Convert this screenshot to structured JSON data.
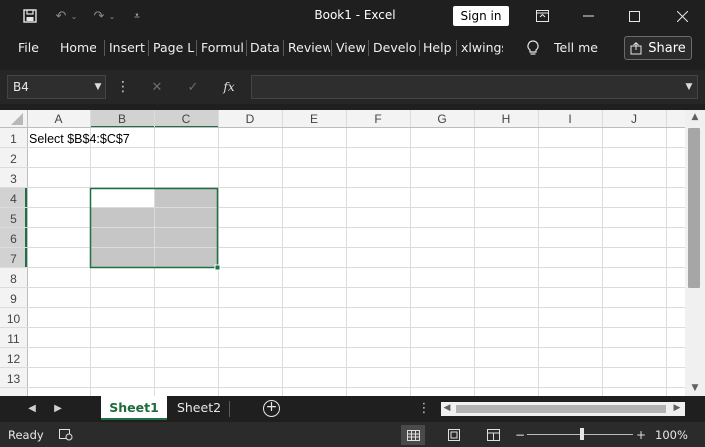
{
  "window": {
    "doc_title": "Book1  -  Excel",
    "sign_in_label": "Sign in"
  },
  "ribbon": {
    "tabs": [
      "File",
      "Home",
      "Insert",
      "Page L",
      "Formul",
      "Data",
      "Review",
      "View",
      "Develo",
      "Help",
      "xlwings"
    ],
    "tell_me": "Tell me",
    "share": "Share"
  },
  "formula_bar": {
    "name_box": "B4",
    "fx_symbol": "fx",
    "value": ""
  },
  "sheet": {
    "columns": [
      "A",
      "B",
      "C",
      "D",
      "E",
      "F",
      "G",
      "H",
      "I",
      "J"
    ],
    "rows": [
      "1",
      "2",
      "3",
      "4",
      "5",
      "6",
      "7",
      "8",
      "9",
      "10",
      "11",
      "12",
      "13"
    ],
    "cells": {
      "A1": "Select $B$4:$C$7"
    },
    "active_cell": "B4",
    "selection": "B4:C7",
    "selection_fill": "#c6c6c6",
    "selection_border": "#1e7145"
  },
  "sheet_tabs": [
    {
      "label": "Sheet1",
      "active": true
    },
    {
      "label": "Sheet2",
      "active": false
    }
  ],
  "status": {
    "ready": "Ready",
    "zoom": "100%",
    "zoom_fraction": 0.5
  },
  "colors": {
    "chrome": "#1f1f1f",
    "accent": "#1e7145"
  }
}
